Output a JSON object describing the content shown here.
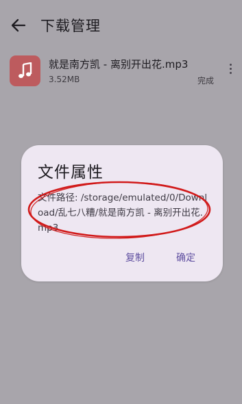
{
  "app_bar": {
    "back_icon": "arrow-left-icon",
    "title": "下载管理"
  },
  "download_item": {
    "icon": "music-note-icon",
    "icon_color": "#bd5b5e",
    "name": "就是南方凯 - 离别开出花.mp3",
    "size": "3.52MB",
    "status": "完成",
    "menu_icon": "more-vertical-icon"
  },
  "dialog": {
    "title": "文件属性",
    "body": "文件路径: /storage/emulated/0/Download/乱七八糟/就是南方凯 - 离别开出花.mp3",
    "copy_label": "复制",
    "confirm_label": "确定"
  },
  "colors": {
    "scrim": "#a8a5ab",
    "dialog_bg": "#eee7f2",
    "accent": "#5f4fa0",
    "annotation": "#d11a1a"
  }
}
